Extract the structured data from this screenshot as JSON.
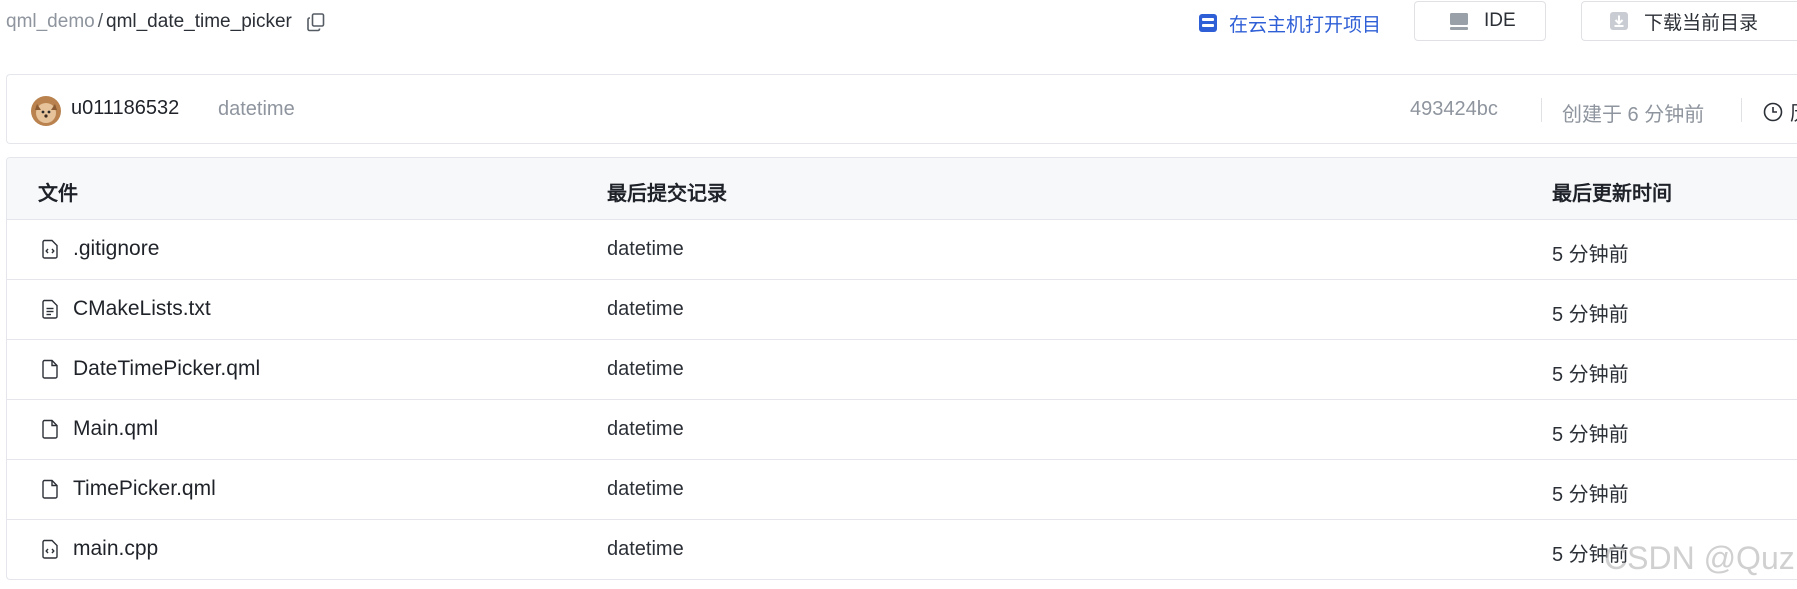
{
  "breadcrumb": {
    "parent": "qml_demo",
    "separator": "/",
    "current": "qml_date_time_picker",
    "copy_icon": "copy-icon"
  },
  "actions": {
    "cloud_open_label": "在云主机打开项目",
    "cloud_icon": "server-icon",
    "ide_label": "IDE",
    "ide_icon": "monitor-icon",
    "download_label": "下载当前目录",
    "download_icon": "download-icon"
  },
  "commit": {
    "username": "u011186532",
    "message": "datetime",
    "hash": "493424bc",
    "created": "创建于 6 分钟前",
    "history_label": "历史",
    "history_icon": "clock-icon"
  },
  "table": {
    "headers": {
      "file": "文件",
      "last_commit": "最后提交记录",
      "last_update": "最后更新时间"
    },
    "rows": [
      {
        "name": ".gitignore",
        "commit": "datetime",
        "time": "5 分钟前",
        "icon": "code-file-icon"
      },
      {
        "name": "CMakeLists.txt",
        "commit": "datetime",
        "time": "5 分钟前",
        "icon": "text-file-icon"
      },
      {
        "name": "DateTimePicker.qml",
        "commit": "datetime",
        "time": "5 分钟前",
        "icon": "file-icon"
      },
      {
        "name": "Main.qml",
        "commit": "datetime",
        "time": "5 分钟前",
        "icon": "file-icon"
      },
      {
        "name": "TimePicker.qml",
        "commit": "datetime",
        "time": "5 分钟前",
        "icon": "file-icon"
      },
      {
        "name": "main.cpp",
        "commit": "datetime",
        "time": "5 分钟前",
        "icon": "code-file-icon"
      }
    ]
  },
  "watermark": "CSDN @Quz",
  "colors": {
    "accent_blue": "#2f5fd6",
    "muted_text": "#8f959e",
    "border": "#e4e6eb",
    "header_bg": "#f7f8fa"
  }
}
